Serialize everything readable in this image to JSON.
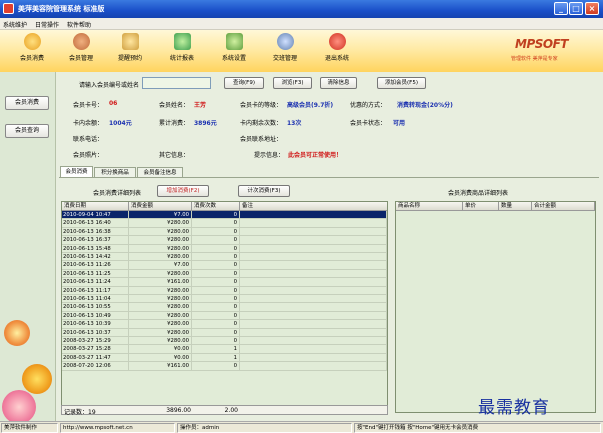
{
  "window": {
    "title": "美萍美容院管理系统 标准版"
  },
  "menu": [
    "系统维护",
    "日常操作",
    "软件帮助"
  ],
  "toolbar": [
    {
      "label": "会员消费",
      "icon": "member-consume-icon",
      "color": "#e8a020"
    },
    {
      "label": "会员管理",
      "icon": "member-manage-icon",
      "color": "#c06a3a"
    },
    {
      "label": "提醒预约",
      "icon": "reminder-icon",
      "color": "#d0a040"
    },
    {
      "label": "统计报表",
      "icon": "report-icon",
      "color": "#40a050"
    },
    {
      "label": "系统设置",
      "icon": "settings-icon",
      "color": "#60a040"
    },
    {
      "label": "交班管理",
      "icon": "shift-icon",
      "color": "#6080b0"
    },
    {
      "label": "退出系统",
      "icon": "exit-icon",
      "color": "#d03020"
    }
  ],
  "brand": {
    "logo": "MPSOFT",
    "slogan": "管理软件 美萍是专家"
  },
  "left_nav": [
    "会员消费",
    "会员查询"
  ],
  "search": {
    "label": "请输入会员编号或姓名",
    "value": "",
    "buttons": [
      "查询(F9)",
      "浏览(F3)",
      "清除信息",
      "添加会员(F5)"
    ]
  },
  "member": {
    "card_no_label": "会员卡号：",
    "card_no": "06",
    "name_label": "会员姓名：",
    "name": "王芳",
    "level_label": "会员卡的等级：",
    "level": "高级会员(9.7折)",
    "discount_label": "优惠的方式：",
    "discount": "消费转现金(20%分)",
    "balance_label": "卡内余额：",
    "balance": "1004元",
    "total_label": "累计消费：",
    "total": "3896元",
    "times_label": "卡内剩余次数：",
    "times": "13次",
    "status_label": "会员卡状态：",
    "status": "可用",
    "phone_label": "联系电话：",
    "address_label": "会员联系地址：",
    "photo_label": "会员照片：",
    "other_label": "其它信息：",
    "tip_label": "提示信息：",
    "tip": "此会员可正常使用！"
  },
  "tabs": [
    "会员消费",
    "积分换商品",
    "会员备注信息"
  ],
  "list_title": "会员消费详细列表",
  "add_consume_btn": "增加消费(F2)",
  "count_consume_btn": "计次消费(F3)",
  "detail_title": "会员消费商品详细列表",
  "table": {
    "columns": [
      "消费日期",
      "消费金额",
      "消费次数",
      "备注"
    ],
    "rows": [
      [
        "2010-09-04 10:47",
        "¥7.00",
        "0",
        ""
      ],
      [
        "2010-06-13 16:40",
        "¥280.00",
        "0",
        ""
      ],
      [
        "2010-06-13 16:38",
        "¥280.00",
        "0",
        ""
      ],
      [
        "2010-06-13 16:37",
        "¥280.00",
        "0",
        ""
      ],
      [
        "2010-06-13 15:48",
        "¥280.00",
        "0",
        ""
      ],
      [
        "2010-06-13 14:42",
        "¥280.00",
        "0",
        ""
      ],
      [
        "2010-06-13 11:26",
        "¥7.00",
        "0",
        ""
      ],
      [
        "2010-06-13 11:25",
        "¥280.00",
        "0",
        ""
      ],
      [
        "2010-06-13 11:24",
        "¥161.00",
        "0",
        ""
      ],
      [
        "2010-06-13 11:17",
        "¥280.00",
        "0",
        ""
      ],
      [
        "2010-06-13 11:04",
        "¥280.00",
        "0",
        ""
      ],
      [
        "2010-06-13 10:55",
        "¥280.00",
        "0",
        ""
      ],
      [
        "2010-06-13 10:49",
        "¥280.00",
        "0",
        ""
      ],
      [
        "2010-06-13 10:39",
        "¥280.00",
        "0",
        ""
      ],
      [
        "2010-06-13 10:37",
        "¥280.00",
        "0",
        ""
      ],
      [
        "2008-03-27 15:29",
        "¥280.00",
        "0",
        ""
      ],
      [
        "2008-03-27 15:28",
        "¥0.00",
        "1",
        ""
      ],
      [
        "2008-03-27 11:47",
        "¥0.00",
        "1",
        ""
      ],
      [
        "2008-07-20 12:06",
        "¥161.00",
        "0",
        ""
      ]
    ],
    "footer": {
      "label": "记录数：19",
      "total": "3896.00",
      "times": "2.00"
    }
  },
  "detail_columns": [
    "商品名称",
    "单价",
    "数量",
    "合计金额"
  ],
  "statusbar": [
    "美萍软件制作",
    "http://www.mpsoft.net.cn",
    "操作员：admin",
    "按\"End\"键打开钱箱 按\"Home\"键用无卡会员消费"
  ],
  "watermark": "最需教育"
}
